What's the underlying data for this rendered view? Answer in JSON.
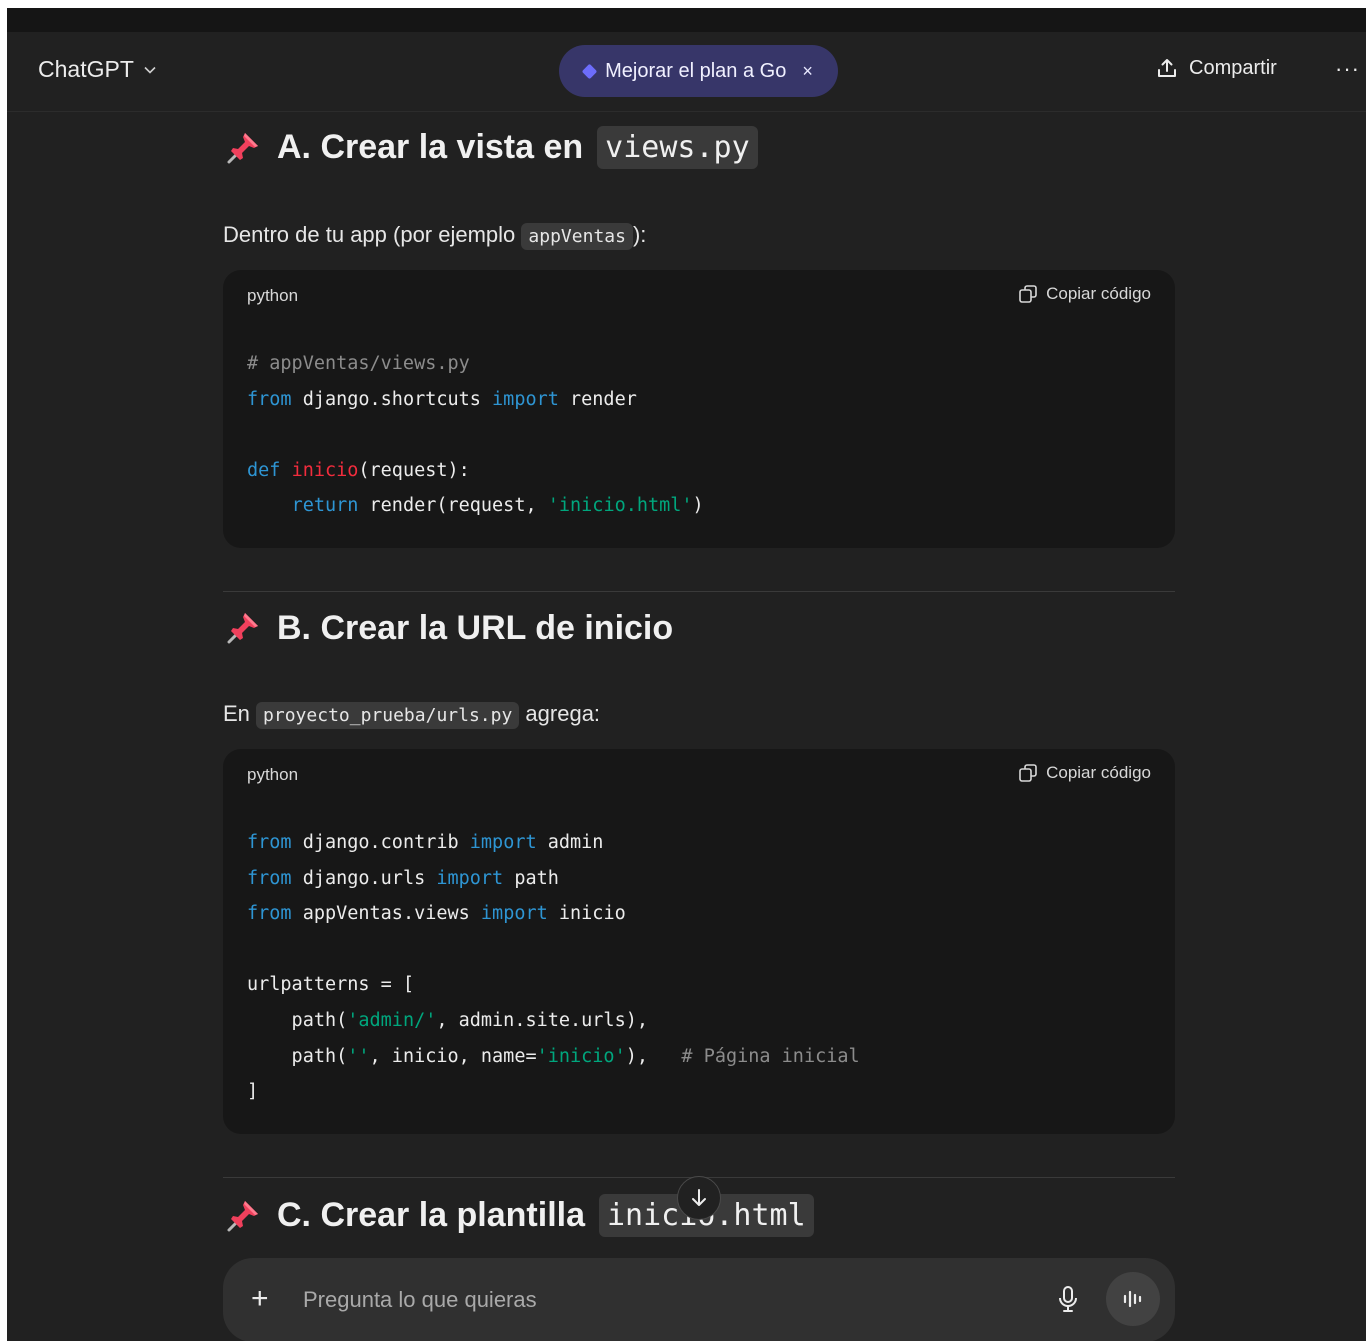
{
  "header": {
    "model": "ChatGPT",
    "upgrade_label": "Mejorar el plan a Go",
    "upgrade_close": "×",
    "share_label": "Compartir",
    "more_label": "···"
  },
  "section_a": {
    "title": "A. Crear la vista en",
    "title_code": "views.py",
    "intro_before": "Dentro de tu app (por ejemplo",
    "intro_code": "appVentas",
    "intro_after": "):",
    "lang": "python",
    "copy_label": "Copiar código",
    "code": {
      "l1": "# appVentas/views.py",
      "l2_kw1": "from",
      "l2_mid": " django.shortcuts ",
      "l2_kw2": "import",
      "l2_end": " render",
      "l4_kw": "def",
      "l4_fn": "inicio",
      "l4_end": "(request):",
      "l5_kw": "return",
      "l5_mid": " render(request, ",
      "l5_str": "'inicio.html'",
      "l5_end": ")"
    }
  },
  "section_b": {
    "title": "B. Crear la URL de inicio",
    "intro_before": "En",
    "intro_code": "proyecto_prueba/urls.py",
    "intro_after": "agrega:",
    "lang": "python",
    "copy_label": "Copiar código",
    "code": {
      "l1_kw1": "from",
      "l1_mid": " django.contrib ",
      "l1_kw2": "import",
      "l1_end": " admin",
      "l2_kw1": "from",
      "l2_mid": " django.urls ",
      "l2_kw2": "import",
      "l2_end": " path",
      "l3_kw1": "from",
      "l3_mid": " appVentas.views ",
      "l3_kw2": "import",
      "l3_end": " inicio",
      "l5": "urlpatterns = [",
      "l6_a": "    path(",
      "l6_str": "'admin/'",
      "l6_b": ", admin.site.urls),",
      "l7_a": "    path(",
      "l7_str1": "''",
      "l7_b": ", inicio, name=",
      "l7_str2": "'inicio'",
      "l7_c": "),   ",
      "l7_cm": "# Página inicial",
      "l8": "]"
    }
  },
  "section_c": {
    "title": "C. Crear la plantilla",
    "title_code": "inicio.html"
  },
  "composer": {
    "placeholder": "Pregunta lo que quieras",
    "plus": "+"
  }
}
